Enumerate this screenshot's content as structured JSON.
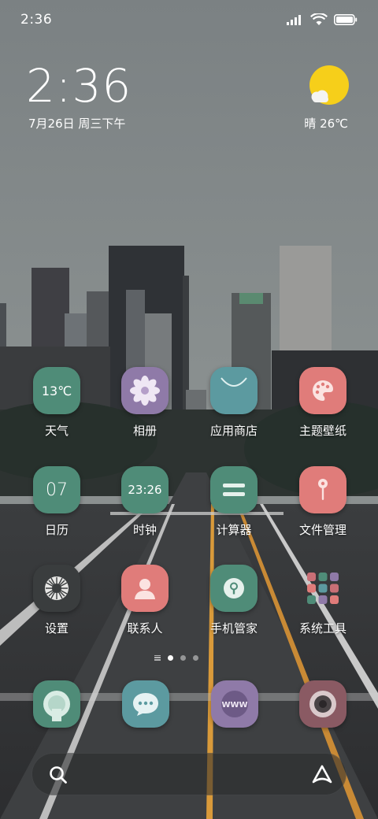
{
  "status_bar": {
    "time": "2:36",
    "battery_level": 1.0
  },
  "clock_widget": {
    "time": "2:36",
    "date": "7月26日 周三下午"
  },
  "weather_widget": {
    "text": "晴 26℃",
    "icon": "sunny-partly-cloudy-icon"
  },
  "apps": [
    {
      "label": "天气",
      "tile_text": "13℃",
      "icon": "weather-icon",
      "color": "#4f8c78"
    },
    {
      "label": "相册",
      "tile_text": "",
      "icon": "flower-gallery-icon",
      "color": "#8f7aa8"
    },
    {
      "label": "应用商店",
      "tile_text": "",
      "icon": "shopping-bag-icon",
      "color": "#5c9aa0"
    },
    {
      "label": "主题壁纸",
      "tile_text": "",
      "icon": "palette-icon",
      "color": "#e07c7a"
    },
    {
      "label": "日历",
      "tile_text": "07",
      "icon": "calendar-icon",
      "color": "#4f8c78"
    },
    {
      "label": "时钟",
      "tile_text": "23:26",
      "icon": "clock-icon",
      "color": "#4f8c78"
    },
    {
      "label": "计算器",
      "tile_text": "",
      "icon": "equals-icon",
      "color": "#4f8c78"
    },
    {
      "label": "文件管理",
      "tile_text": "",
      "icon": "pin-icon",
      "color": "#e07c7a"
    },
    {
      "label": "设置",
      "tile_text": "",
      "icon": "gear-icon",
      "color": "#3a3d3e"
    },
    {
      "label": "联系人",
      "tile_text": "",
      "icon": "person-icon",
      "color": "#e07c7a"
    },
    {
      "label": "手机管家",
      "tile_text": "",
      "icon": "shield-lock-icon",
      "color": "#4f8c78"
    },
    {
      "label": "系统工具",
      "tile_text": "",
      "icon": "folder-grid-icon",
      "color": "transparent"
    }
  ],
  "dock": [
    {
      "name": "phone",
      "icon": "phone-circle-icon",
      "color": "#4f8c78"
    },
    {
      "name": "messages",
      "icon": "chat-bubble-icon",
      "color": "#5c9aa0"
    },
    {
      "name": "browser",
      "icon": "www-globe-icon",
      "color": "#8f7aa8"
    },
    {
      "name": "camera",
      "icon": "camera-lens-icon",
      "color": "#8a5a63"
    }
  ],
  "pager": {
    "pages": 3,
    "current": 1
  },
  "search": {
    "icons": [
      "search-icon",
      "assistant-icon"
    ]
  }
}
